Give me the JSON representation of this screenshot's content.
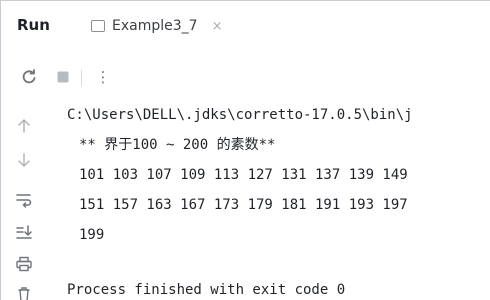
{
  "header": {
    "run_label": "Run",
    "tab_label": "Example3_7",
    "tab_close": "×"
  },
  "toolbar": {
    "more_glyph": "⋮"
  },
  "console": {
    "command_line": "C:\\Users\\DELL\\.jdks\\corretto-17.0.5\\bin\\j",
    "heading": "** 界于100 ~ 200 的素数**",
    "row1": "101 103 107 109 113 127 131 137 139 149",
    "row2": "151 157 163 167 173 179 181 191 193 197",
    "row3": "199",
    "exit_message": "Process finished with exit code 0"
  },
  "colors": {
    "text": "#1f2329",
    "icon": "#6f747c",
    "border": "#c9cdd3"
  }
}
